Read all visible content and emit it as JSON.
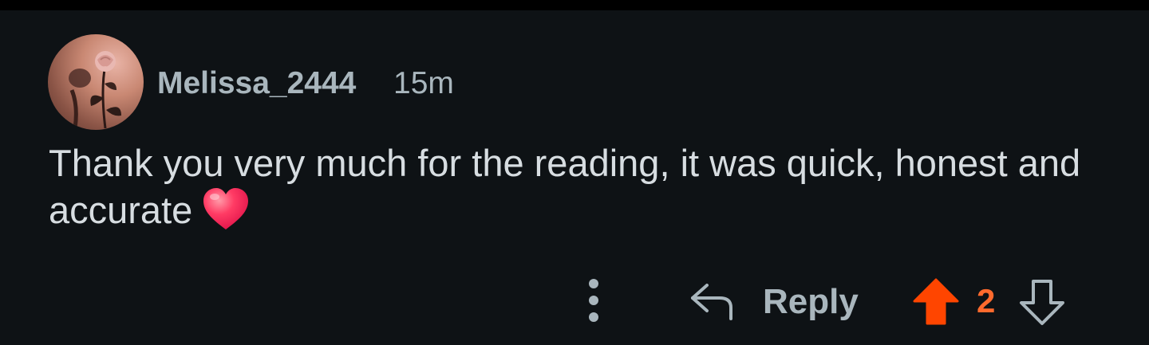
{
  "comment": {
    "username": "Melissa_2444",
    "timestamp": "15m",
    "text": "Thank you very much for the reading, it was quick, honest and accurate",
    "emoji": "heart-emoji"
  },
  "actions": {
    "more_icon": "more-vertical-icon",
    "reply_icon": "reply-arrow-icon",
    "reply_label": "Reply",
    "upvote_icon": "upvote-arrow-icon",
    "vote_count": "2",
    "downvote_icon": "downvote-arrow-icon"
  },
  "colors": {
    "background": "#0e1215",
    "text_primary": "#d7dde1",
    "text_secondary": "#a9b6bd",
    "upvote_active": "#ff4500",
    "vote_count": "#ff6a2d"
  }
}
